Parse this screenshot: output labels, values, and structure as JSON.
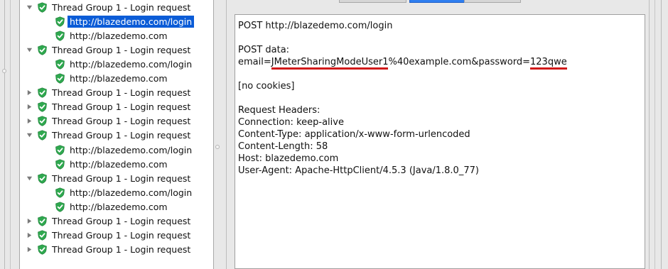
{
  "tree": {
    "items": [
      {
        "kind": "group",
        "expanded": true,
        "label": "Thread Group 1 - Login request"
      },
      {
        "kind": "sample",
        "label": "http://blazedemo.com/login",
        "selected": true
      },
      {
        "kind": "sample",
        "label": "http://blazedemo.com"
      },
      {
        "kind": "group",
        "expanded": true,
        "label": "Thread Group 1 - Login request"
      },
      {
        "kind": "sample",
        "label": "http://blazedemo.com/login"
      },
      {
        "kind": "sample",
        "label": "http://blazedemo.com"
      },
      {
        "kind": "group",
        "expanded": false,
        "label": "Thread Group 1 - Login request"
      },
      {
        "kind": "group",
        "expanded": false,
        "label": "Thread Group 1 - Login request"
      },
      {
        "kind": "group",
        "expanded": false,
        "label": "Thread Group 1 - Login request"
      },
      {
        "kind": "group",
        "expanded": true,
        "label": "Thread Group 1 - Login request"
      },
      {
        "kind": "sample",
        "label": "http://blazedemo.com/login"
      },
      {
        "kind": "sample",
        "label": "http://blazedemo.com"
      },
      {
        "kind": "group",
        "expanded": true,
        "label": "Thread Group 1 - Login request"
      },
      {
        "kind": "sample",
        "label": "http://blazedemo.com/login"
      },
      {
        "kind": "sample",
        "label": "http://blazedemo.com"
      },
      {
        "kind": "group",
        "expanded": false,
        "label": "Thread Group 1 - Login request"
      },
      {
        "kind": "group",
        "expanded": false,
        "label": "Thread Group 1 - Login request"
      },
      {
        "kind": "group",
        "expanded": false,
        "label": "Thread Group 1 - Login request"
      }
    ]
  },
  "request": {
    "line1": "POST http://blazedemo.com/login",
    "post_data_label": "POST data:",
    "email_prefix": "email",
    "email_eq": "=",
    "email_user": "JMeterSharingModeUser1",
    "email_rest": "%40example.com&password",
    "pw_eq": "=",
    "pw_value": "123qwe",
    "cookies": "[no cookies]",
    "headers_label": "Request Headers:",
    "headers": [
      "Connection: keep-alive",
      "Content-Type: application/x-www-form-urlencoded",
      "Content-Length: 58",
      "Host: blazedemo.com",
      "User-Agent: Apache-HttpClient/4.5.3 (Java/1.8.0_77)"
    ]
  },
  "colors": {
    "selection": "#0b5cd7",
    "success_icon": "#2fa84f",
    "highlight_underline": "#d11a1a"
  },
  "icons": {
    "success": "green-shield-check-icon",
    "expanded": "triangle-down-icon",
    "collapsed": "triangle-right-icon"
  }
}
